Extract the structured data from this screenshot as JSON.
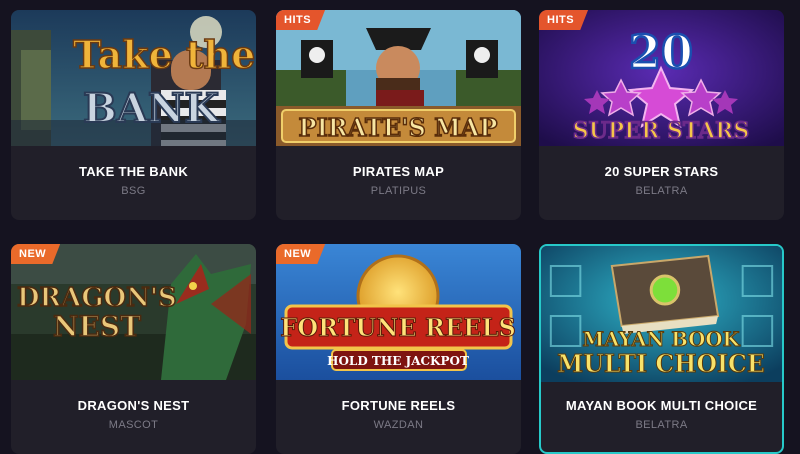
{
  "games": [
    {
      "title": "TAKE THE BANK",
      "provider": "BSG",
      "badge": "",
      "art_text": [
        "Take the",
        "BANK"
      ]
    },
    {
      "title": "PIRATES MAP",
      "provider": "PLATIPUS",
      "badge": "HITS",
      "art_text": [
        "PIRATE'S MAP"
      ]
    },
    {
      "title": "20 SUPER STARS",
      "provider": "BELATRA",
      "badge": "HITS",
      "art_text": [
        "20",
        "SUPER STARS"
      ]
    },
    {
      "title": "DRAGON'S NEST",
      "provider": "MASCOT",
      "badge": "NEW",
      "art_text": [
        "DRAGON'S",
        "NEST"
      ]
    },
    {
      "title": "FORTUNE REELS",
      "provider": "WAZDAN",
      "badge": "NEW",
      "art_text": [
        "FORTUNE REELS",
        "HOLD THE JACKPOT"
      ]
    },
    {
      "title": "MAYAN BOOK MULTI CHOICE",
      "provider": "BELATRA",
      "badge": "",
      "art_text": [
        "MAYAN BOOK",
        "MULTI CHOICE"
      ]
    }
  ],
  "colors": {
    "page_bg": "#151320",
    "card_bg": "#211f29",
    "badge": "#e4552c",
    "active_border": "#27c9c9",
    "provider_text": "#7c7a86"
  }
}
